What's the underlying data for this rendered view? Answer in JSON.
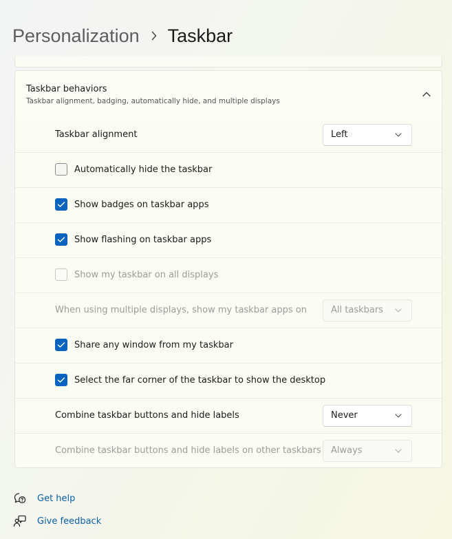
{
  "breadcrumb": {
    "parent": "Personalization",
    "current": "Taskbar",
    "separator_icon": "chevron-right-icon"
  },
  "section": {
    "title": "Taskbar behaviors",
    "description": "Taskbar alignment, badging, automatically hide, and multiple displays",
    "expanded": true,
    "collapse_icon": "chevron-up-icon"
  },
  "settings": {
    "alignment": {
      "label": "Taskbar alignment",
      "value": "Left"
    },
    "auto_hide": {
      "label": "Automatically hide the taskbar",
      "checked": false
    },
    "badges": {
      "label": "Show badges on taskbar apps",
      "checked": true
    },
    "flashing": {
      "label": "Show flashing on taskbar apps",
      "checked": true
    },
    "all_displays": {
      "label": "Show my taskbar on all displays",
      "checked": false,
      "disabled": true
    },
    "multi_display_apps": {
      "label": "When using multiple displays, show my taskbar apps on",
      "value": "All taskbars",
      "disabled": true
    },
    "share_window": {
      "label": "Share any window from my taskbar",
      "checked": true
    },
    "far_corner": {
      "label": "Select the far corner of the taskbar to show the desktop",
      "checked": true
    },
    "combine": {
      "label": "Combine taskbar buttons and hide labels",
      "value": "Never"
    },
    "combine_other": {
      "label": "Combine taskbar buttons and hide labels on other taskbars",
      "value": "Always",
      "disabled": true
    }
  },
  "footer": {
    "help": {
      "label": "Get help",
      "icon": "help-chat-icon"
    },
    "feedback": {
      "label": "Give feedback",
      "icon": "feedback-icon"
    }
  },
  "colors": {
    "accent": "#0a64bf",
    "link": "#0b5ea8"
  }
}
